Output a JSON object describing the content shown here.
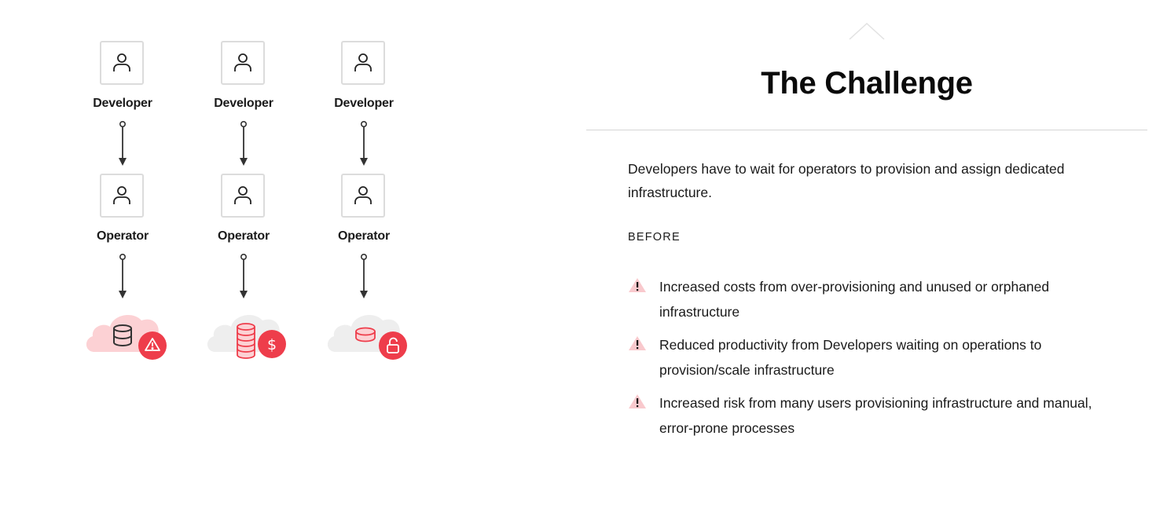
{
  "diagram": {
    "columns": [
      {
        "top_role": {
          "label": "Developer",
          "icon": "user-icon"
        },
        "bottom_role": {
          "label": "Operator",
          "icon": "user-icon"
        },
        "outcome": {
          "cloud_icon": "cloud-icon",
          "database_icon": "database-icon",
          "badge_icon": "warning-triangle-icon",
          "cloud_color": "#fcd1d4",
          "badge_color": "#ee3d4b"
        }
      },
      {
        "top_role": {
          "label": "Developer",
          "icon": "user-icon"
        },
        "bottom_role": {
          "label": "Operator",
          "icon": "user-icon"
        },
        "outcome": {
          "cloud_icon": "cloud-icon",
          "database_icon": "database-stack-icon",
          "badge_icon": "dollar-icon",
          "cloud_color": "#eeeeee",
          "badge_color": "#ee3d4b"
        }
      },
      {
        "top_role": {
          "label": "Developer",
          "icon": "user-icon"
        },
        "bottom_role": {
          "label": "Operator",
          "icon": "user-icon"
        },
        "outcome": {
          "cloud_icon": "cloud-icon",
          "database_icon": "database-icon",
          "badge_icon": "unlock-icon",
          "cloud_color": "#eeeeee",
          "badge_color": "#ee3d4b"
        }
      }
    ]
  },
  "panel": {
    "caret_icon": "caret-up-icon",
    "title": "The Challenge",
    "intro": "Developers have to wait for operators to provision and assign dedicated infrastructure.",
    "section_label": "BEFORE",
    "issues": [
      {
        "icon": "warning-icon",
        "text": "Increased costs from over-provisioning and unused or orphaned infrastructure"
      },
      {
        "icon": "warning-icon",
        "text": "Reduced productivity from Developers waiting on operations to provision/scale infrastructure"
      },
      {
        "icon": "warning-icon",
        "text": "Increased risk from many users provisioning infrastructure and manual, error-prone processes"
      }
    ]
  },
  "colors": {
    "accent": "#ee3d4b",
    "accent_light": "#fcd1d4",
    "neutral_cloud": "#eeeeee",
    "box_border": "#dcdcdc",
    "divider": "#d6d6d6"
  }
}
